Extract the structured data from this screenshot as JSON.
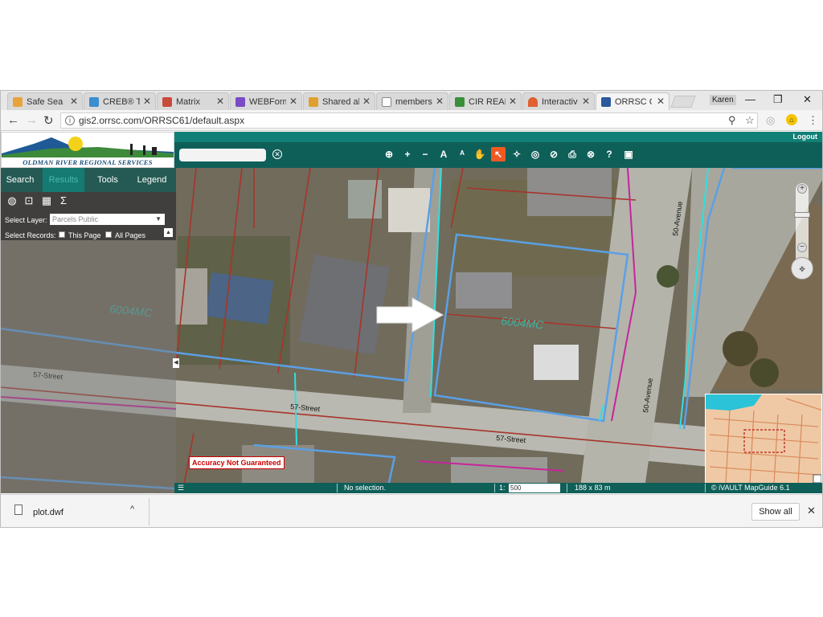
{
  "tabs": [
    {
      "label": "Safe Searc",
      "icon": "check-icon",
      "color": "#e8a33d"
    },
    {
      "label": "CREB® To",
      "icon": "document-icon",
      "color": "#3b8ed0"
    },
    {
      "label": "Matrix",
      "icon": "matrix-icon",
      "color": "#c94a3a"
    },
    {
      "label": "WEBForm",
      "icon": "webforms-icon",
      "color": "#7a4bc4"
    },
    {
      "label": "Shared all",
      "icon": "pinwheel-icon",
      "color": "#e0a030"
    },
    {
      "label": "members",
      "icon": "page-icon",
      "color": "#888888"
    },
    {
      "label": "CIR REALT",
      "icon": "cir-icon",
      "color": "#3a8f3a"
    },
    {
      "label": "Interactiv",
      "icon": "rainbow-icon",
      "color": "#e06030"
    },
    {
      "label": "ORRSC GI",
      "icon": "orrsc-icon",
      "color": "#2a5a9a"
    }
  ],
  "browser": {
    "user": "Karen",
    "url": "gis2.orrsc.com/ORRSC61/default.aspx"
  },
  "app": {
    "logo_text": "OLDMAN RIVER REGIONAL SERVICES COMMISSION",
    "logout": "Logout",
    "panel_tabs": [
      "Search",
      "Results",
      "Tools",
      "Legend"
    ],
    "active_tab": "Results",
    "select_layer_label": "Select Layer:",
    "select_layer_value": "Parcels Public",
    "select_records_label": "Select Records:",
    "this_page": "This Page",
    "all_pages": "All Pages",
    "search_placeholder": "",
    "accuracy": "Accuracy Not Guaranteed"
  },
  "map_labels": {
    "parcel_main": "6004MC",
    "parcel_left": "6004MC",
    "street_57_a": "57-Street",
    "street_57_b": "57-Street",
    "street_57_c": "57-Street",
    "avenue_50_a": "50-Avenue",
    "avenue_50_b": "50-Avenue"
  },
  "status": {
    "selection": "No selection.",
    "scale_prefix": "1:",
    "scale_value": "500",
    "extent": "188 x 83 m",
    "credit": "© iVAULT MapGuide 6.1"
  },
  "download": {
    "file": "plot.dwf",
    "show_all": "Show all"
  },
  "colors": {
    "teal_bar": "#0f5f59",
    "highlight_tool": "#f05a22",
    "parcel_blue": "#5aa0e6",
    "parcel_red": "#a8342a",
    "parcel_cyan": "#2ee0e0",
    "parcel_magenta": "#c8249a"
  }
}
